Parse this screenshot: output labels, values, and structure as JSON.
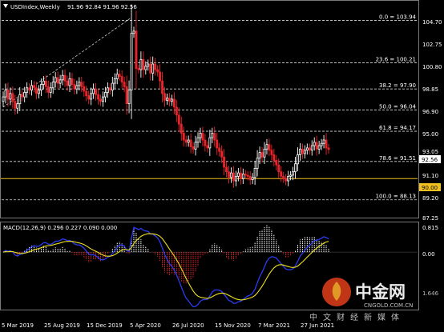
{
  "header": {
    "symbol": "USDIndex,Weekly",
    "ohlc": "91.96 92.84 91.96 92.56"
  },
  "price_axis": {
    "ticks": [
      "104.70",
      "102.75",
      "100.80",
      "98.85",
      "96.90",
      "95.00",
      "93.05",
      "91.10",
      "89.20",
      "87.25"
    ],
    "current_price": "92.56",
    "hline_price": "90.00"
  },
  "fib_levels": [
    {
      "label": "0.0 = 103.94",
      "value": 103.94
    },
    {
      "label": "23.6 = 100.21",
      "value": 100.21
    },
    {
      "label": "38.2 = 97.90",
      "value": 97.9
    },
    {
      "label": "50.0 = 96.04",
      "value": 96.04
    },
    {
      "label": "61.8 = 94.17",
      "value": 94.17
    },
    {
      "label": "78.6 = 91.51",
      "value": 91.51
    },
    {
      "label": "100.0 = 88.13",
      "value": 88.13
    }
  ],
  "macd": {
    "label": "MACD(12,26,9) 0.296 0.227 0.090 0.000",
    "ticks": [
      "0.815",
      "0.00"
    ],
    "bottom_tick": "1.646"
  },
  "time_axis": {
    "labels": [
      "5 Mar 2019",
      "25 Aug 2019",
      "15 Dec 2019",
      "5 Apr 2020",
      "26 Jul 2020",
      "15 Nov 2020",
      "7 Mar 2021",
      "27 Jun 2021"
    ]
  },
  "watermark": {
    "brand_cn": "中金网",
    "url": "CNGOLD.COM.CN",
    "tagline": "中文财经新媒体"
  },
  "colors": {
    "bull": "#ffffff",
    "bear": "#e8242a",
    "fib": "#d8d8d8",
    "hline": "#f0c020",
    "macd_line": "#2a3cf0",
    "signal_line": "#f0e020",
    "histogram_pos": "#ffffff",
    "histogram_neg": "#e8242a"
  },
  "chart_data": {
    "type": "candlestick",
    "closes": [
      97.2,
      97.8,
      97.0,
      97.5,
      96.8,
      96.2,
      96.6,
      97.4,
      97.2,
      97.6,
      98.0,
      97.8,
      98.2,
      98.0,
      97.5,
      97.8,
      98.3,
      98.6,
      98.1,
      97.6,
      98.0,
      98.5,
      98.9,
      98.4,
      98.7,
      99.1,
      98.6,
      98.2,
      98.8,
      98.3,
      97.9,
      98.2,
      98.5,
      98.1,
      97.7,
      97.3,
      97.0,
      97.5,
      97.9,
      97.4,
      97.0,
      96.8,
      97.2,
      97.6,
      98.0,
      97.8,
      98.4,
      98.8,
      99.2,
      99.0,
      98.5,
      98.1,
      96.6,
      97.8,
      102.8,
      103.0,
      99.7,
      99.6,
      100.5,
      99.6,
      99.9,
      100.1,
      99.3,
      100.1,
      99.6,
      99.4,
      98.6,
      97.5,
      96.9,
      97.1,
      96.8,
      97.0,
      96.3,
      95.6,
      94.8,
      94.0,
      93.4,
      93.2,
      93.4,
      92.8,
      92.6,
      93.2,
      93.6,
      94.0,
      93.4,
      92.9,
      92.7,
      93.6,
      94.0,
      93.4,
      92.7,
      92.4,
      91.9,
      91.0,
      90.6,
      90.1,
      90.5,
      89.8,
      90.2,
      90.5,
      90.0,
      90.4,
      90.3,
      90.2,
      89.9,
      90.1,
      90.9,
      91.8,
      92.3,
      91.9,
      92.6,
      93.0,
      92.5,
      92.1,
      91.6,
      91.2,
      90.6,
      90.2,
      90.0,
      89.8,
      90.2,
      90.3,
      90.6,
      91.3,
      92.1,
      92.6,
      92.2,
      92.5,
      92.7,
      92.5,
      92.9,
      93.2,
      92.6,
      92.9,
      93.1,
      93.4,
      92.7,
      92.56
    ],
    "ylim": [
      86.7,
      105.6
    ],
    "fib_high": 103.94,
    "fib_low": 88.13,
    "hline": 90.0,
    "macd_ylim": [
      -1.646,
      0.815
    ]
  }
}
